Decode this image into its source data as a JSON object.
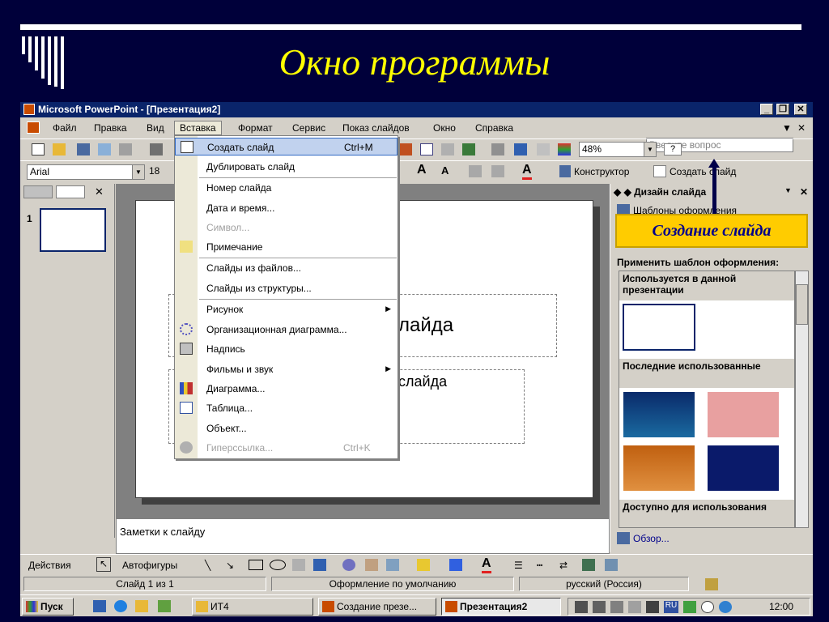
{
  "slide": {
    "title": "Окно программы"
  },
  "window": {
    "title": "Microsoft PowerPoint - [Презентация2]",
    "min": "_",
    "max": "❐",
    "close": "✕"
  },
  "menu": {
    "items": [
      "Файл",
      "Правка",
      "Вид",
      "Вставка",
      "Формат",
      "Сервис",
      "Показ слайдов",
      "Окно",
      "Справка"
    ],
    "active_index": 3,
    "ask_placeholder": "Введите вопрос",
    "ask_arrow": "▼",
    "doc_close": "✕"
  },
  "toolbar": {
    "zoom": "48%",
    "font": "Arial",
    "font_size": "18",
    "designer_label": "Конструктор",
    "new_slide_label": "Создать слайд"
  },
  "insert_menu": {
    "items": [
      {
        "label": "Создать слайд",
        "shortcut": "Ctrl+M",
        "highlighted": true,
        "disabled": false,
        "icon": "new-slide-icon"
      },
      {
        "label": "Дублировать слайд",
        "disabled": false
      },
      {
        "label": "Номер слайда",
        "disabled": false
      },
      {
        "label": "Дата и время...",
        "disabled": false
      },
      {
        "label": "Символ...",
        "disabled": true
      },
      {
        "label": "Примечание",
        "disabled": false,
        "icon": "comment-icon"
      },
      {
        "label": "Слайды из файлов...",
        "disabled": false
      },
      {
        "label": "Слайды из структуры...",
        "disabled": false
      },
      {
        "label": "Рисунок",
        "disabled": false,
        "submenu": true
      },
      {
        "label": "Организационная диаграмма...",
        "disabled": false,
        "icon": "org-chart-icon"
      },
      {
        "label": "Надпись",
        "disabled": false,
        "icon": "text-box-icon"
      },
      {
        "label": "Фильмы и звук",
        "disabled": false,
        "submenu": true
      },
      {
        "label": "Диаграмма...",
        "disabled": false,
        "icon": "chart-icon"
      },
      {
        "label": "Таблица...",
        "disabled": false,
        "icon": "table-icon"
      },
      {
        "label": "Объект...",
        "disabled": false
      },
      {
        "label": "Гиперссылка...",
        "shortcut": "Ctrl+K",
        "disabled": true,
        "icon": "hyperlink-icon"
      }
    ]
  },
  "left_pane": {
    "slide_number": "1",
    "close": "✕"
  },
  "slide_edit": {
    "title_placeholder_fragment": "лайда",
    "subtitle_placeholder_fragment": "слайда"
  },
  "notes": {
    "placeholder": "Заметки к слайду"
  },
  "task_pane": {
    "title": "Дизайн слайда",
    "links": [
      "Шаблоны оформления"
    ],
    "apply_label": "Применить шаблон оформления:",
    "section_used": "Используется в данной презентации",
    "section_recent": "Последние использованные",
    "section_available": "Доступно для использования",
    "browse": "Обзор...",
    "close": "✕",
    "dropdown": "▼"
  },
  "callout": {
    "text": "Создание слайда"
  },
  "drawing_toolbar": {
    "actions": "Действия",
    "autoshapes": "Автофигуры"
  },
  "status": {
    "slide": "Слайд 1 из 1",
    "design": "Оформление по умолчанию",
    "language": "русский (Россия)"
  },
  "taskbar": {
    "start": "Пуск",
    "buttons": [
      "ИТ4",
      "Создание презе...",
      "Презентация2"
    ],
    "clock": "12:00",
    "lang": "RU"
  },
  "colors": {
    "title_yellow": "#ffff00",
    "bg_navy": "#00003a",
    "titlebar": "#0a246a",
    "callout": "#ffcc00"
  }
}
